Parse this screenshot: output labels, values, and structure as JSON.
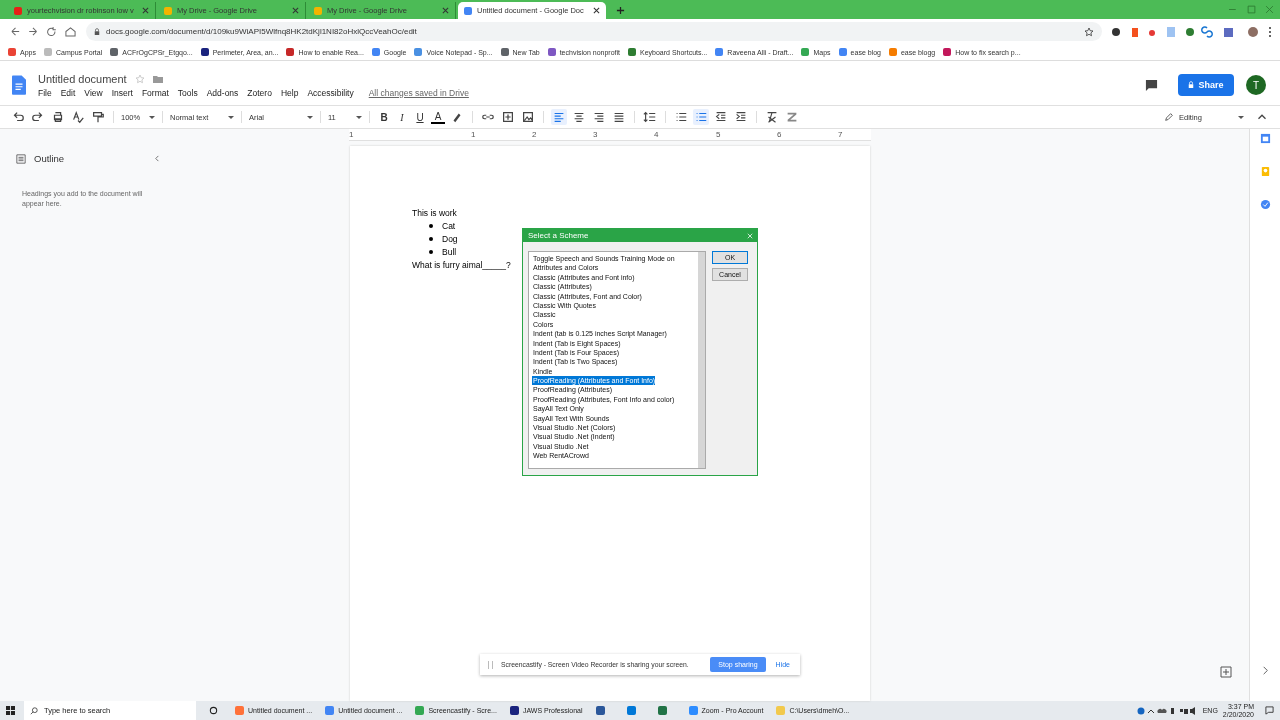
{
  "browser": {
    "tabs": [
      {
        "title": "yourtechvision dr robinson low v",
        "selected": false,
        "color": "#e62117"
      },
      {
        "title": "My Drive - Google Drive",
        "selected": false,
        "color": "#f4b400"
      },
      {
        "title": "My Drive - Google Drive",
        "selected": false,
        "color": "#f4b400"
      },
      {
        "title": "Untitled document - Google Doc",
        "selected": true,
        "color": "#4285f4"
      }
    ],
    "url": "docs.google.com/document/d/109ku9WiAPI5Wlfnq8HK2tdKjl1NI82oHxlQccVeahOc/edit",
    "bookmarks": [
      {
        "label": "Apps",
        "color": "#ea4335"
      },
      {
        "label": "Campus Portal",
        "color": "#bbbbbb"
      },
      {
        "label": "ACFrOgCPSr_Etgqo...",
        "color": "#5f6368"
      },
      {
        "label": "Perimeter, Area, an...",
        "color": "#1a237e"
      },
      {
        "label": "How to enable Rea...",
        "color": "#c62828"
      },
      {
        "label": "Google",
        "color": "#4285f4"
      },
      {
        "label": "Voice Notepad - Sp...",
        "color": "#4a90e2"
      },
      {
        "label": "New Tab",
        "color": "#5f6368"
      },
      {
        "label": "techvision nonprofit",
        "color": "#7e57c2"
      },
      {
        "label": "Keyboard Shortcuts...",
        "color": "#2e7d32"
      },
      {
        "label": "Raveena Alli - Draft...",
        "color": "#4285f4"
      },
      {
        "label": "Maps",
        "color": "#34a853"
      },
      {
        "label": "ease blog",
        "color": "#4285f4"
      },
      {
        "label": "ease blogg",
        "color": "#f57c00"
      },
      {
        "label": "How to fix search p...",
        "color": "#c2185b"
      }
    ]
  },
  "docs": {
    "title": "Untitled document",
    "menus": [
      "File",
      "Edit",
      "View",
      "Insert",
      "Format",
      "Tools",
      "Add-ons",
      "Zotero",
      "Help",
      "Accessibility"
    ],
    "save_status": "All changes saved in Drive",
    "share": "Share",
    "avatar": "T",
    "toolbar": {
      "zoom": "100%",
      "style": "Normal text",
      "font": "Arial",
      "size": "11",
      "format": [
        "B",
        "I",
        "U",
        "A"
      ],
      "alignment": [
        {
          "selected": true
        },
        {
          "selected": false
        },
        {
          "selected": false
        },
        {
          "selected": false
        }
      ],
      "lists": [
        {
          "selected": false
        },
        {
          "selected": true
        }
      ],
      "mode": "Editing"
    },
    "ruler": [
      "1",
      "1",
      "2",
      "3",
      "4",
      "5",
      "6",
      "7"
    ],
    "outline": {
      "title": "Outline",
      "hint": "Headings you add to the document will appear here."
    },
    "document": {
      "lines": [
        {
          "kind": "text",
          "text": "This is work"
        },
        {
          "kind": "bullet",
          "text": "Cat"
        },
        {
          "kind": "bullet",
          "text": "Dog"
        },
        {
          "kind": "bullet",
          "text": "Bull"
        },
        {
          "kind": "text",
          "text": "What is furry aimal_____?"
        }
      ]
    }
  },
  "dialog": {
    "title": "Select a Scheme",
    "items": [
      {
        "label": "Toggle Speech and Sounds Training Mode on",
        "selected": false
      },
      {
        "label": "Attributes and Colors",
        "selected": false
      },
      {
        "label": "Classic (Attributes and Font info)",
        "selected": false
      },
      {
        "label": "Classic (Attributes)",
        "selected": false
      },
      {
        "label": "Classic (Attributes, Font and Color)",
        "selected": false
      },
      {
        "label": "Classic With Quotes",
        "selected": false
      },
      {
        "label": "Classic",
        "selected": false
      },
      {
        "label": "Colors",
        "selected": false
      },
      {
        "label": "Indent (tab is 0.125 inches Script Manager)",
        "selected": false
      },
      {
        "label": "Indent (Tab is Eight Spaces)",
        "selected": false
      },
      {
        "label": "Indent (Tab is Four Spaces)",
        "selected": false
      },
      {
        "label": "Indent (Tab is Two Spaces)",
        "selected": false
      },
      {
        "label": "Kindle",
        "selected": false
      },
      {
        "label": "ProofReading (Attributes and Font Info)",
        "selected": true
      },
      {
        "label": "ProofReading (Attributes)",
        "selected": false
      },
      {
        "label": "ProofReading (Attributes, Font Info and color)",
        "selected": false
      },
      {
        "label": "SayAll Text Only",
        "selected": false
      },
      {
        "label": "SayAll Text With Sounds",
        "selected": false
      },
      {
        "label": "Visual Studio .Net (Colors)",
        "selected": false
      },
      {
        "label": "Visual Studio .Net (Indent)",
        "selected": false
      },
      {
        "label": "Visual Studio .Net",
        "selected": false
      },
      {
        "label": "Web RentACrowd",
        "selected": false
      }
    ],
    "buttons": [
      "OK",
      "Cancel"
    ]
  },
  "screencastify": {
    "message": "Screencastify - Screen Video Recorder is sharing your screen.",
    "stop": "Stop sharing",
    "hide": "Hide"
  },
  "taskbar": {
    "search_placeholder": "Type here to search",
    "apps": [
      {
        "label": "Untitled document ...",
        "color": "#ff7139"
      },
      {
        "label": "Untitled document ...",
        "color": "#4285f4"
      },
      {
        "label": "Screencastify - Scre...",
        "color": "#34a853"
      },
      {
        "label": "JAWS Professional",
        "color": "#1a237e"
      },
      {
        "color": "#2b579a"
      },
      {
        "color": "#0078d7"
      },
      {
        "color": "#217346"
      },
      {
        "label": "Zoom - Pro Account",
        "color": "#2d8cff"
      },
      {
        "label": "C:\\Users\\dmeh\\O...",
        "color": "#f2c94c"
      }
    ],
    "lang": "ENG",
    "time": "3:37 PM",
    "date": "2/20/2020"
  }
}
